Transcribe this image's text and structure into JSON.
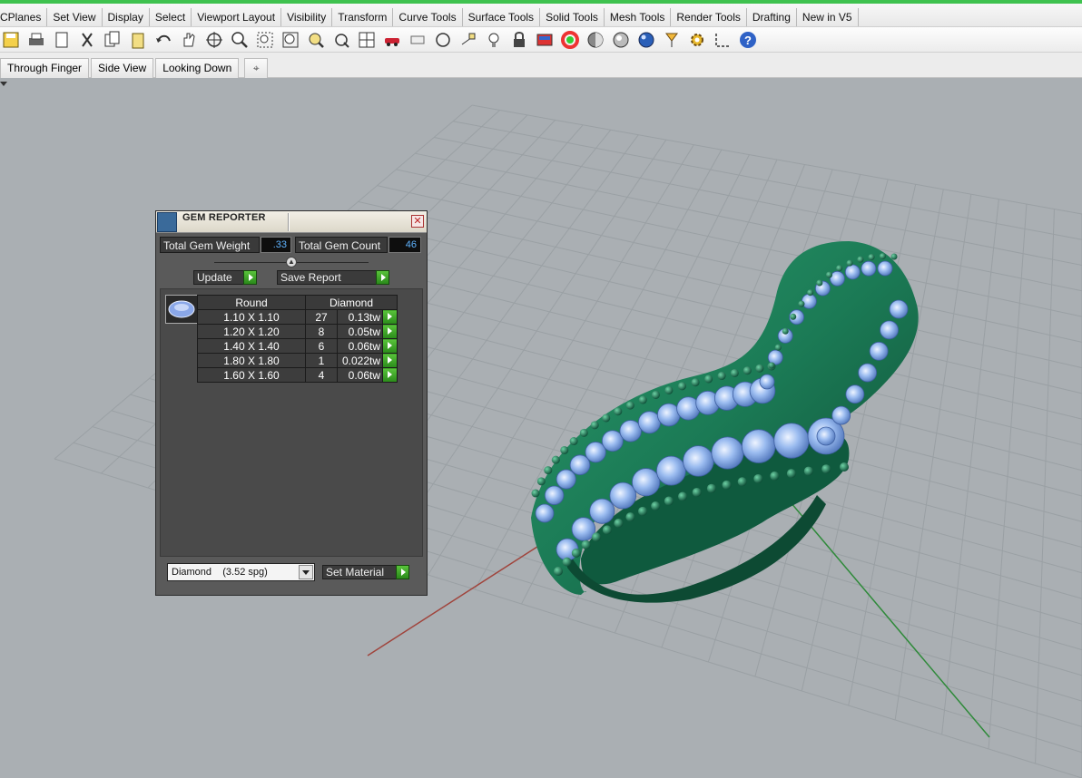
{
  "menu_tabs": [
    "CPlanes",
    "Set View",
    "Display",
    "Select",
    "Viewport Layout",
    "Visibility",
    "Transform",
    "Curve Tools",
    "Surface Tools",
    "Solid Tools",
    "Mesh Tools",
    "Render Tools",
    "Drafting",
    "New in V5"
  ],
  "toolbar_icons": [
    "save-icon",
    "print-icon",
    "paste-page-icon",
    "cut-icon",
    "copy-icon",
    "clipboard-icon",
    "undo-icon",
    "pan-hand-icon",
    "rotate-view-icon",
    "zoom-icon",
    "zoom-window-icon",
    "zoom-extents-icon",
    "zoom-selected-icon",
    "undo-view-icon",
    "four-viewports-icon",
    "car-icon",
    "unknown-icon",
    "circle-icon",
    "cplane-icon",
    "light-icon",
    "lock-icon",
    "material-icon",
    "color-wheel-icon",
    "shade-icon",
    "render-icon",
    "sphere-icon",
    "arrow-flag-icon",
    "settings-gear-icon",
    "dimension-icon",
    "help-icon"
  ],
  "viewport_tabs": [
    "Through Finger",
    "Side View",
    "Looking Down"
  ],
  "gem_reporter": {
    "title": "GEM REPORTER",
    "close": "✕",
    "total_weight_label": "Total Gem Weight",
    "total_weight_value": ".33",
    "total_count_label": "Total Gem Count",
    "total_count_value": "46",
    "update_label": "Update",
    "save_report_label": "Save Report",
    "table": {
      "col_shape": "Round",
      "col_material": "Diamond",
      "rows": [
        {
          "size": "1.10 X 1.10",
          "count": "27",
          "tw": "0.13tw"
        },
        {
          "size": "1.20 X 1.20",
          "count": "8",
          "tw": "0.05tw"
        },
        {
          "size": "1.40 X 1.40",
          "count": "6",
          "tw": "0.06tw"
        },
        {
          "size": "1.80 X 1.80",
          "count": "1",
          "tw": "0.022tw"
        },
        {
          "size": "1.60 X 1.60",
          "count": "4",
          "tw": "0.06tw"
        }
      ]
    },
    "material_select": "Diamond    (3.52 spg)",
    "set_material_label": "Set Material"
  },
  "colors": {
    "accent_green": "#3fc24f",
    "ring_green": "#1b7a55",
    "gem_blue": "#7fa8e6",
    "viewport_bg": "#aaafb3",
    "panel_bg": "#5a5a5a"
  }
}
